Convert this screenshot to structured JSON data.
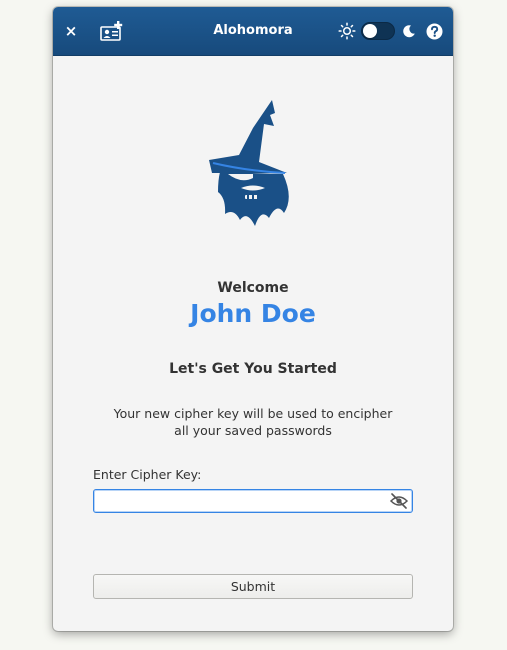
{
  "window": {
    "title": "Alohomora"
  },
  "header": {
    "close_glyph": "×",
    "icons": [
      "close-icon",
      "account-card-icon",
      "sun-icon",
      "moon-icon",
      "help-icon"
    ],
    "dark_mode_enabled": false
  },
  "main": {
    "welcome": "Welcome",
    "user_name": "John Doe",
    "heading": "Let's Get You Started",
    "description_line1": "Your new cipher key will be used to encipher",
    "description_line2": "all your saved passwords",
    "key_label": "Enter Cipher Key:",
    "key_value": "",
    "submit_label": "Submit"
  },
  "colors": {
    "headerbar": "#1a5087",
    "accent": "#3584e4",
    "logo": "#1a5087",
    "text": "#333333",
    "window_bg": "#f4f4f4"
  }
}
